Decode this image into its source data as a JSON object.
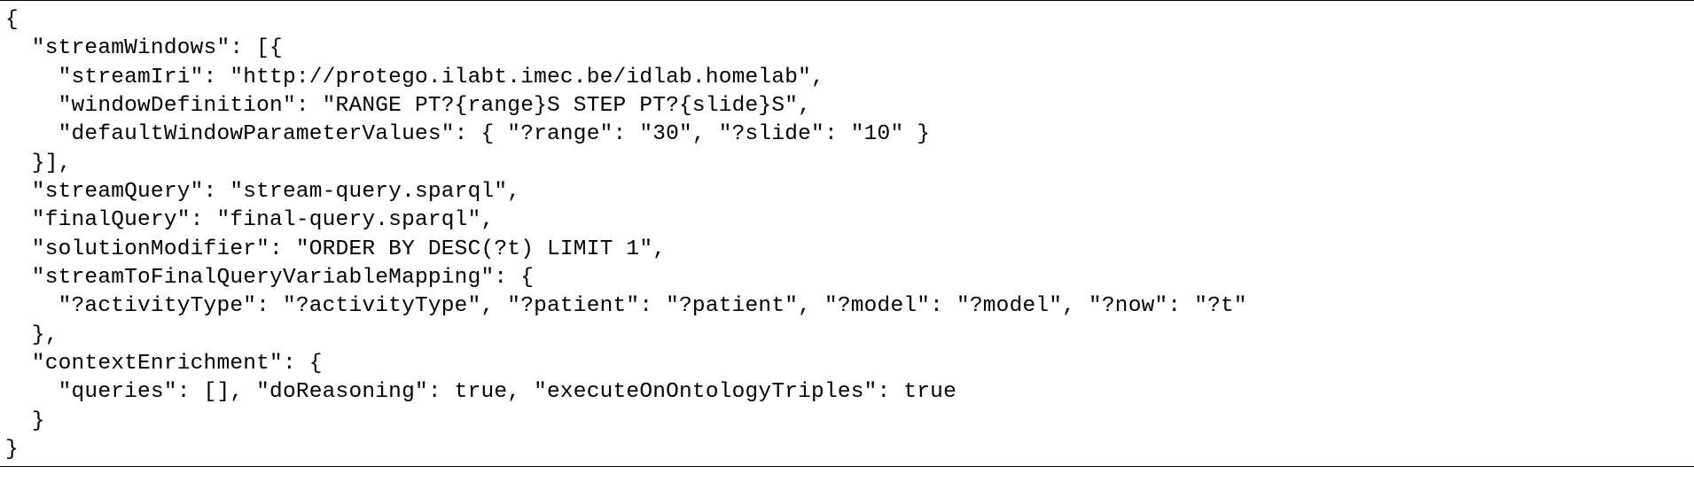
{
  "code": {
    "l01": "{",
    "l02": "  \"streamWindows\": [{",
    "l03": "    \"streamIri\": \"http://protego.ilabt.imec.be/idlab.homelab\",",
    "l04": "    \"windowDefinition\": \"RANGE PT?{range}S STEP PT?{slide}S\",",
    "l05": "    \"defaultWindowParameterValues\": { \"?range\": \"30\", \"?slide\": \"10\" }",
    "l06": "  }],",
    "l07": "  \"streamQuery\": \"stream-query.sparql\",",
    "l08": "  \"finalQuery\": \"final-query.sparql\",",
    "l09": "  \"solutionModifier\": \"ORDER BY DESC(?t) LIMIT 1\",",
    "l10": "  \"streamToFinalQueryVariableMapping\": {",
    "l11": "    \"?activityType\": \"?activityType\", \"?patient\": \"?patient\", \"?model\": \"?model\", \"?now\": \"?t\"",
    "l12": "  },",
    "l13": "  \"contextEnrichment\": {",
    "l14": "    \"queries\": [], \"doReasoning\": true, \"executeOnOntologyTriples\": true",
    "l15": "  }",
    "l16": "}"
  }
}
